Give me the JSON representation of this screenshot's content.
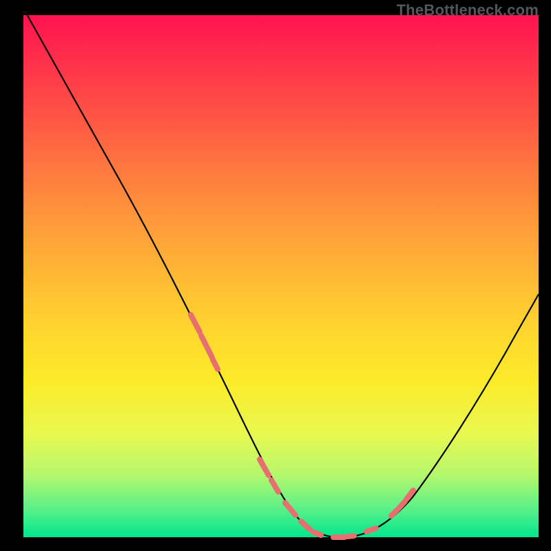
{
  "watermark": "TheBottleneck.com",
  "colors": {
    "background_frame": "#000000",
    "gradient_top": "#ff1350",
    "gradient_mid1": "#ff9b3a",
    "gradient_mid2": "#fceb29",
    "gradient_bottom": "#00e68c",
    "curve_stroke": "#000000",
    "marker_fill": "#e76f6f",
    "watermark_text": "#53575b"
  },
  "chart_data": {
    "type": "line",
    "title": "",
    "xlabel": "",
    "ylabel": "",
    "xlim": [
      0,
      100
    ],
    "ylim": [
      0,
      100
    ],
    "note": "No axes, ticks, legend, or data labels are rendered in the image; values below are estimated from pixel positions on a 0–100 normalized coordinate system where y=100 is the top of the gradient and y=0 is the bottom.",
    "series": [
      {
        "name": "bottleneck-curve",
        "x": [
          0,
          5,
          10,
          15,
          20,
          25,
          30,
          35,
          40,
          45,
          50,
          55,
          60,
          65,
          70,
          75,
          80,
          85,
          90,
          95,
          100
        ],
        "values": [
          100,
          92,
          83,
          74,
          64,
          54,
          44,
          33,
          23,
          13,
          5,
          1,
          0,
          1,
          4,
          9,
          15,
          22,
          30,
          38,
          47
        ]
      }
    ],
    "markers": {
      "name": "highlight-points",
      "note": "Salmon dash/dot clusters along the curve near the valley and on each rising arm",
      "x": [
        33,
        34,
        35,
        36,
        39,
        40,
        44,
        48,
        52,
        55,
        57,
        58,
        60,
        63,
        64,
        66,
        71,
        72,
        73,
        74,
        75,
        76
      ],
      "values": [
        37,
        35,
        33,
        31,
        25,
        23,
        15,
        8,
        4,
        1,
        0,
        0,
        0,
        1,
        1,
        2,
        6,
        7,
        8,
        9,
        10,
        11
      ]
    }
  }
}
